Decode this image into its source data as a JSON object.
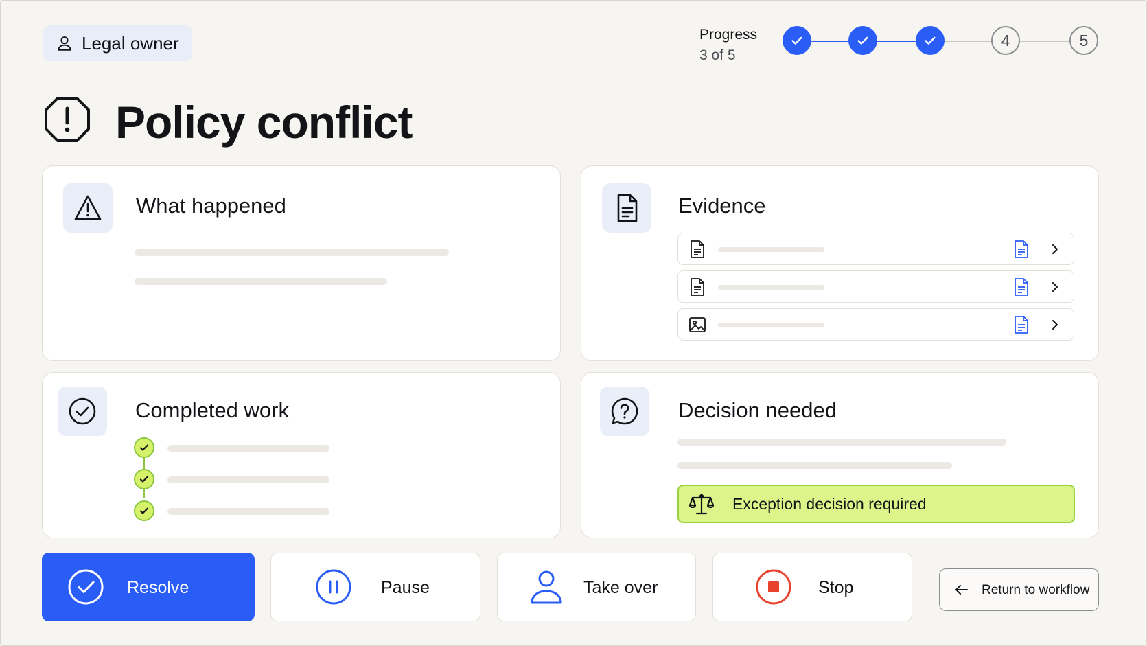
{
  "owner": {
    "label": "Legal owner",
    "icon": "user-icon"
  },
  "progress": {
    "label": "Progress",
    "count": "3 of 5",
    "current": 3,
    "total": 5,
    "steps": [
      {
        "state": "done"
      },
      {
        "state": "done"
      },
      {
        "state": "done"
      },
      {
        "state": "pending",
        "number": "4"
      },
      {
        "state": "pending",
        "number": "5"
      }
    ]
  },
  "page": {
    "title": "Policy conflict",
    "icon": "alert-octagon-icon"
  },
  "cards": {
    "what_happened": {
      "title": "What happened",
      "icon": "warning-triangle-icon"
    },
    "evidence": {
      "title": "Evidence",
      "icon": "document-icon",
      "items": [
        {
          "type_icon": "document-icon",
          "attach_icon": "document-blue-icon"
        },
        {
          "type_icon": "document-icon",
          "attach_icon": "document-blue-icon"
        },
        {
          "type_icon": "image-icon",
          "attach_icon": "document-blue-icon"
        }
      ]
    },
    "completed_work": {
      "title": "Completed work",
      "icon": "check-circle-icon",
      "items_done": 3
    },
    "decision_needed": {
      "title": "Decision needed",
      "icon": "question-bubble-icon",
      "banner": "Exception decision required",
      "banner_icon": "scales-icon"
    }
  },
  "actions": {
    "resolve": "Resolve",
    "pause": "Pause",
    "take_over": "Take over",
    "stop": "Stop",
    "return": "Return to workflow"
  },
  "colors": {
    "accent": "#2a5cf6",
    "stop": "#e8412c",
    "success_fill": "#dcf58a",
    "success_border": "#9bd040",
    "background": "#f7f5f1"
  }
}
